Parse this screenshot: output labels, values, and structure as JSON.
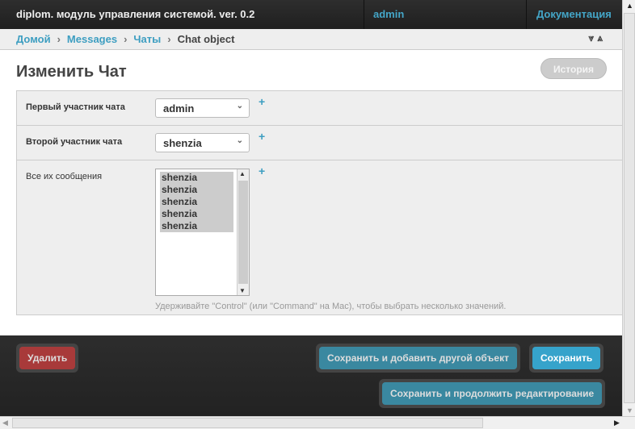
{
  "header": {
    "brand": "diplom. модуль управления системой. ver. 0.2",
    "user": "admin",
    "docs": "Документация"
  },
  "breadcrumb": {
    "items": [
      "Домой",
      "Messages",
      "Чаты"
    ],
    "current": "Chat object",
    "sep": "›",
    "toggle": "⩔⩓"
  },
  "title": "Изменить Чат",
  "history_button": "История",
  "form": {
    "field1": {
      "label": "Первый участник чата",
      "value": "admin"
    },
    "field2": {
      "label": "Второй участник чата",
      "value": "shenzia"
    },
    "field3": {
      "label": "Все их сообщения",
      "options": [
        "shenzia",
        "shenzia",
        "shenzia",
        "shenzia",
        "shenzia"
      ],
      "help": "Удерживайте \"Control\" (или \"Command\" на Mac), чтобы выбрать несколько значений."
    },
    "plus": "+",
    "chev": "⌄"
  },
  "footer": {
    "delete": "Удалить",
    "save_add": "Сохранить и добавить другой объект",
    "save": "Сохранить",
    "save_continue": "Сохранить и продолжить редактирование"
  }
}
